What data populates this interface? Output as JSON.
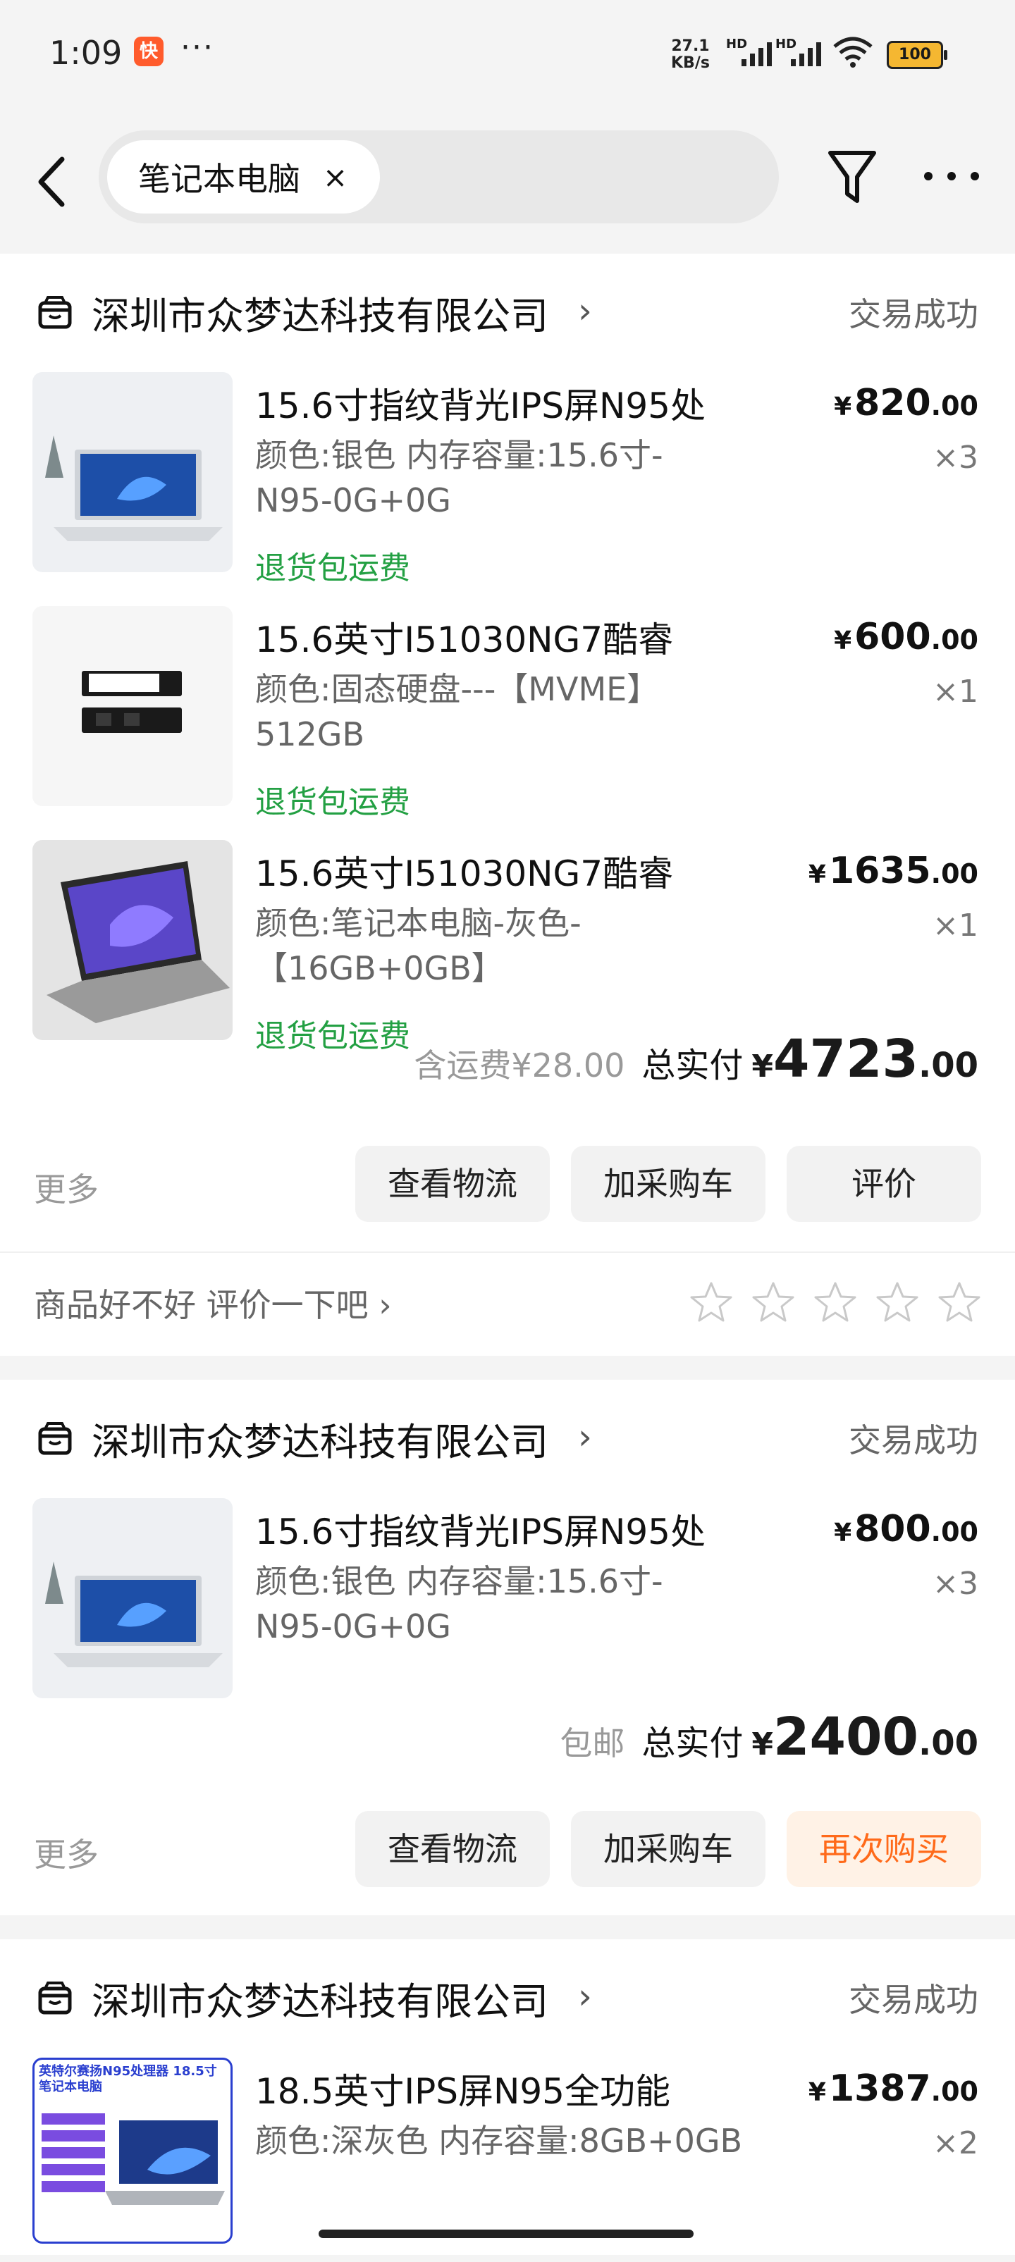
{
  "status_bar": {
    "time": "1:09",
    "app_badge": "快",
    "dots": "···",
    "net_speed": "27.1",
    "net_unit": "KB/s",
    "hd1": "HD",
    "hd2": "HD",
    "battery": "100"
  },
  "search": {
    "chip_text": "笔记本电脑",
    "clear": "×"
  },
  "orders": [
    {
      "shop": "深圳市众梦达科技有限公司",
      "status": "交易成功",
      "items": [
        {
          "title": "15.6寸指纹背光IPS屏N95处",
          "spec": "颜色:银色 内存容量:15.6寸-N95-0G+0G",
          "tag": "退货包运费",
          "price_int": "820",
          "price_dec": ".00",
          "qty": "×3"
        },
        {
          "title": "15.6英寸I51030NG7酷睿",
          "spec": "颜色:固态硬盘---【MVME】512GB",
          "tag": "退货包运费",
          "price_int": "600",
          "price_dec": ".00",
          "qty": "×1"
        },
        {
          "title": "15.6英寸I51030NG7酷睿",
          "spec": "颜色:笔记本电脑-灰色-【16GB+0GB】",
          "tag": "退货包运费",
          "price_int": "1635",
          "price_dec": ".00",
          "qty": "×1"
        }
      ],
      "shipping": "含运费¥28.00",
      "total_label": "总实付",
      "total_int": "4723",
      "total_dec": ".00",
      "more": "更多",
      "buttons": [
        "查看物流",
        "加采购车",
        "评价"
      ],
      "rate_prompt": "商品好不好 评价一下吧"
    },
    {
      "shop": "深圳市众梦达科技有限公司",
      "status": "交易成功",
      "items": [
        {
          "title": "15.6寸指纹背光IPS屏N95处",
          "spec": "颜色:银色 内存容量:15.6寸-N95-0G+0G",
          "price_int": "800",
          "price_dec": ".00",
          "qty": "×3"
        }
      ],
      "shipping": "包邮",
      "total_label": "总实付",
      "total_int": "2400",
      "total_dec": ".00",
      "more": "更多",
      "buttons": [
        "查看物流",
        "加采购车",
        "再次购买"
      ]
    },
    {
      "shop": "深圳市众梦达科技有限公司",
      "status": "交易成功",
      "items": [
        {
          "title": "18.5英寸IPS屏N95全功能",
          "spec": "颜色:深灰色 内存容量:8GB+0GB",
          "price_int": "1387",
          "price_dec": ".00",
          "qty": "×2",
          "thumb_text": "英特尔赛扬N95处理器 18.5寸笔记本电脑"
        }
      ]
    }
  ],
  "currency": "¥",
  "rating": {
    "stars": 5,
    "filled": 0
  },
  "colors": {
    "accent": "#ff6a1a",
    "tag_green": "#23a043",
    "bg": "#f4f4f4"
  }
}
